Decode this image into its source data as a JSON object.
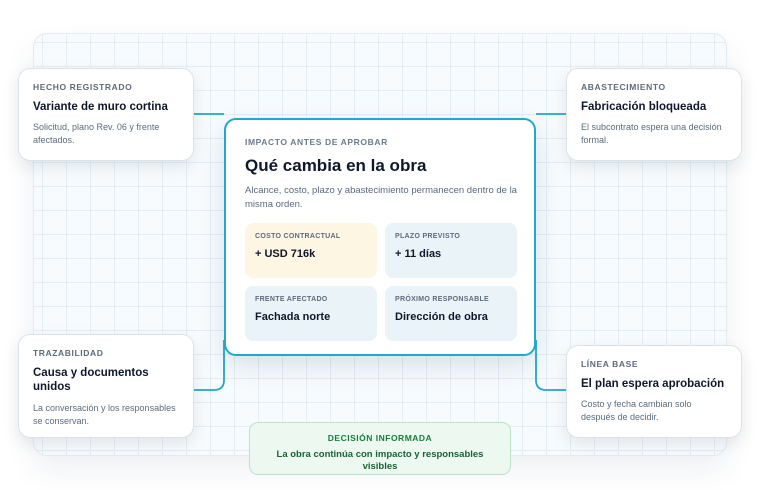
{
  "main": {
    "eyebrow": "IMPACTO ANTES DE APROBAR",
    "title": "Qué cambia en la obra",
    "description": "Alcance, costo, plazo y abastecimiento permanecen dentro de la misma orden.",
    "tiles": [
      {
        "label": "COSTO CONTRACTUAL",
        "value": "+ USD 716k"
      },
      {
        "label": "PLAZO PREVISTO",
        "value": "+ 11 días"
      },
      {
        "label": "FRENTE AFECTADO",
        "value": "Fachada norte"
      },
      {
        "label": "PRÓXIMO RESPONSABLE",
        "value": "Dirección de obra"
      }
    ]
  },
  "side_cards": {
    "hecho": {
      "eyebrow": "HECHO REGISTRADO",
      "title": "Variante de muro cortina",
      "description": "Solicitud, plano Rev. 06 y frente afectados."
    },
    "abastecimiento": {
      "eyebrow": "ABASTECIMIENTO",
      "title": "Fabricación bloqueada",
      "description": "El subcontrato espera una decisión formal."
    },
    "trazabilidad": {
      "eyebrow": "TRAZABILIDAD",
      "title": "Causa y documentos unidos",
      "description": "La conversación y los responsables se conservan."
    },
    "linea_base": {
      "eyebrow": "LÍNEA BASE",
      "title": "El plan espera aprobación",
      "description": "Costo y fecha cambian solo después de decidir."
    }
  },
  "footer": {
    "eyebrow": "DECISIÓN INFORMADA",
    "text": "La obra continúa con impacto y responsables visibles"
  },
  "colors": {
    "accent": "#22a8c8",
    "cost_tile": "#fdf6e3",
    "tile": "#eaf3f7",
    "success_bg": "#ecf8f0",
    "success_text": "#15803d"
  }
}
